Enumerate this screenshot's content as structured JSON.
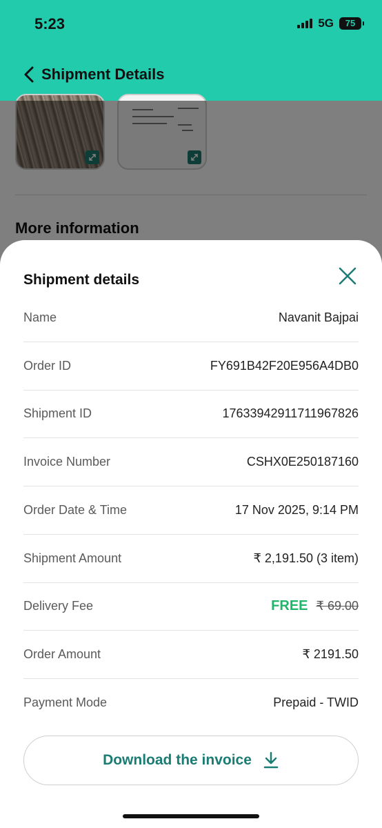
{
  "status_bar": {
    "time": "5:23",
    "network": "5G",
    "battery": "75"
  },
  "nav": {
    "title": "Shipment Details"
  },
  "background": {
    "section_title": "More information"
  },
  "sheet": {
    "title": "Shipment details",
    "rows": [
      {
        "label": "Name",
        "value": "Navanit Bajpai"
      },
      {
        "label": "Order ID",
        "value": "FY691B42F20E956A4DB0"
      },
      {
        "label": "Shipment ID",
        "value": "17633942911711967826"
      },
      {
        "label": "Invoice Number",
        "value": "CSHX0E250187160"
      },
      {
        "label": "Order Date & Time",
        "value": "17 Nov 2025, 9:14 PM"
      },
      {
        "label": "Shipment Amount",
        "value": "₹ 2,191.50 (3 item)"
      },
      {
        "label": "Delivery Fee",
        "free": "FREE",
        "original": "₹ 69.00"
      },
      {
        "label": "Order Amount",
        "value": "₹ 2191.50"
      },
      {
        "label": "Payment Mode",
        "value": "Prepaid - TWID"
      }
    ],
    "download_label": "Download the invoice"
  },
  "colors": {
    "header": "#22cbac",
    "accent": "#1a7c72",
    "free": "#1fb66b"
  },
  "icons": [
    "back-chevron-icon",
    "close-icon",
    "download-icon",
    "expand-icon"
  ]
}
